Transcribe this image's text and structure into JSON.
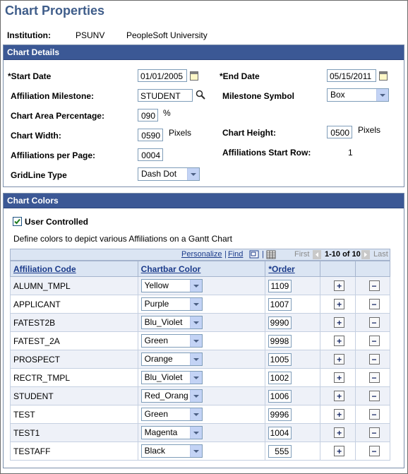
{
  "page": {
    "title": "Chart Properties"
  },
  "institution": {
    "label": "Institution:",
    "code": "PSUNV",
    "name": "PeopleSoft University"
  },
  "chart_details": {
    "header": "Chart Details",
    "start_date": {
      "label": "*Start Date",
      "value": "01/01/2005"
    },
    "end_date": {
      "label": "*End Date",
      "value": "05/15/2011"
    },
    "affiliation_milestone": {
      "label": "Affiliation Milestone:",
      "value": "STUDENT"
    },
    "milestone_symbol": {
      "label": "Milestone Symbol",
      "value": "Box"
    },
    "chart_area_percentage": {
      "label": "Chart Area Percentage:",
      "value": "090",
      "unit": "%"
    },
    "chart_width": {
      "label": "Chart Width:",
      "value": "0590",
      "unit": "Pixels"
    },
    "chart_height": {
      "label": "Chart Height:",
      "value": "0500",
      "unit": "Pixels"
    },
    "affiliations_per_page": {
      "label": "Affiliations per Page:",
      "value": "0004"
    },
    "affiliations_start_row": {
      "label": "Affiliations Start Row:",
      "value": "1"
    },
    "gridline_type": {
      "label": "GridLine Type",
      "value": "Dash Dot"
    }
  },
  "chart_colors": {
    "header": "Chart Colors",
    "user_controlled": {
      "label": "User Controlled",
      "checked": true
    },
    "description": "Define colors to depict various Affiliations on a Gantt Chart",
    "grid_nav": {
      "personalize": "Personalize",
      "separator": "|",
      "find": "Find",
      "first": "First",
      "range": "1-10 of 10",
      "last": "Last"
    },
    "columns": {
      "code": "Affiliation Code",
      "color": "Chartbar Color",
      "order": "*Order"
    },
    "add_symbol": "+",
    "remove_symbol": "−",
    "rows": [
      {
        "code": "ALUMN_TMPL",
        "color": "Yellow",
        "order": "1109"
      },
      {
        "code": "APPLICANT",
        "color": "Purple",
        "order": "1007"
      },
      {
        "code": "FATEST2B",
        "color": "Blu_Violet",
        "order": "9990"
      },
      {
        "code": "FATEST_2A",
        "color": "Green",
        "order": "9998"
      },
      {
        "code": "PROSPECT",
        "color": "Orange",
        "order": "1005"
      },
      {
        "code": "RECTR_TMPL",
        "color": "Blu_Violet",
        "order": "1002"
      },
      {
        "code": "STUDENT",
        "color": "Red_Orang",
        "order": "1006"
      },
      {
        "code": "TEST",
        "color": "Green",
        "order": "9996"
      },
      {
        "code": "TEST1",
        "color": "Magenta",
        "order": "1004"
      },
      {
        "code": "TESTAFF",
        "color": "Black",
        "order": "555"
      }
    ]
  },
  "colors": {
    "header_bg": "#3b5895",
    "title": "#3f5d8a",
    "grid_header": "#dbe5f3",
    "link": "#1a3a8a"
  }
}
